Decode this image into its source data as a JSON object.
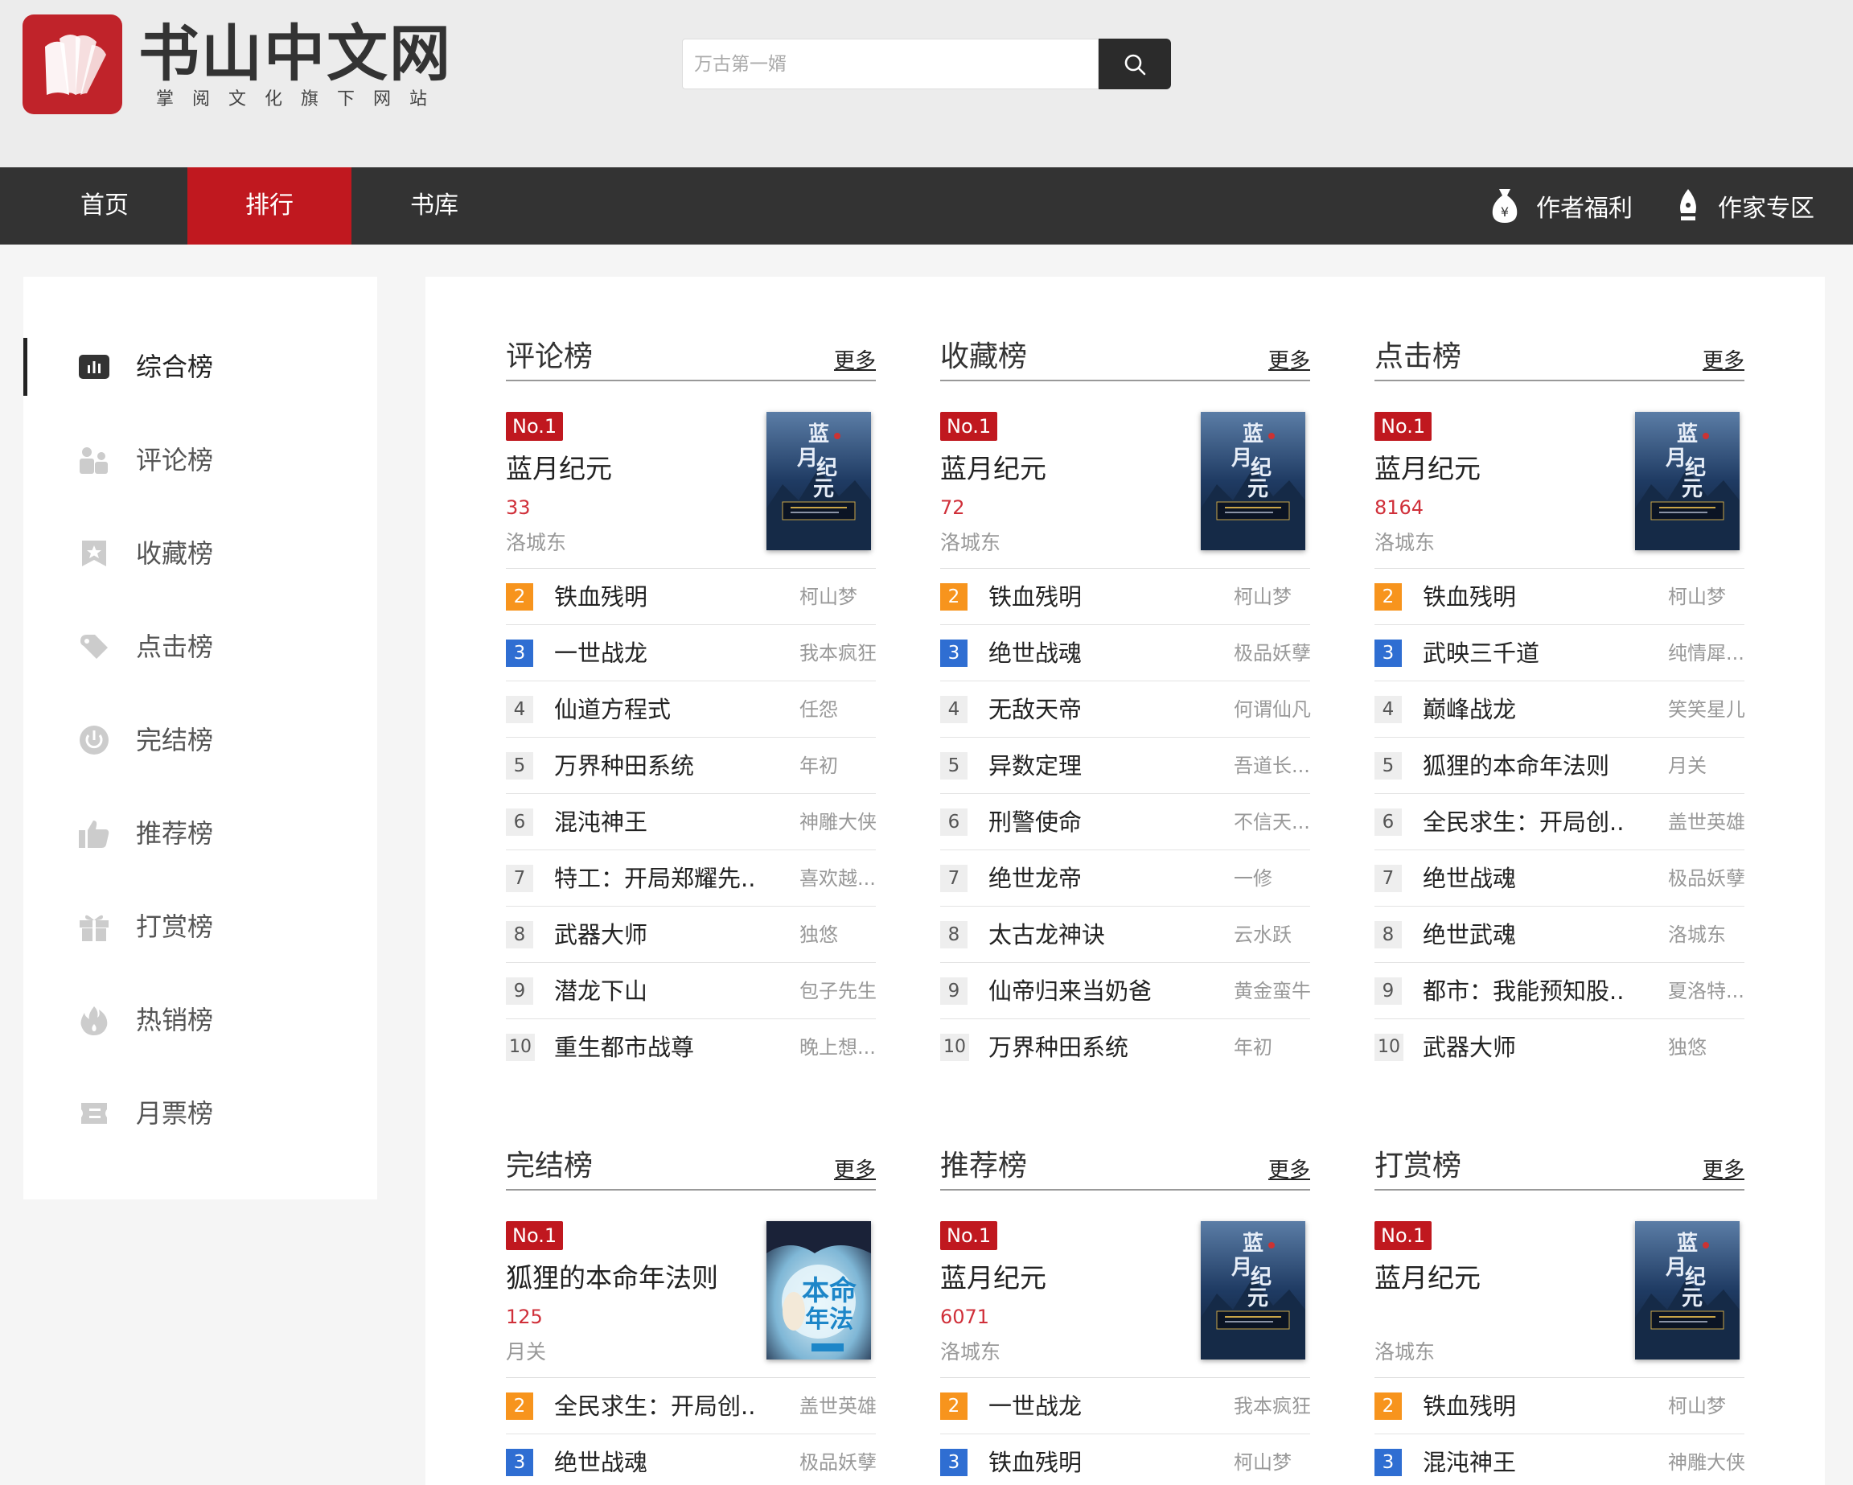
{
  "site": {
    "name": "书山中文网",
    "tagline": "掌阅文化旗下网站"
  },
  "search": {
    "placeholder": "万古第一婿"
  },
  "nav": {
    "items": [
      "首页",
      "排行",
      "书库"
    ],
    "active": "排行",
    "author_welfare": "作者福利",
    "writer_zone": "作家专区"
  },
  "sidebar": {
    "items": [
      {
        "label": "综合榜",
        "icon": "bar-chart-icon"
      },
      {
        "label": "评论榜",
        "icon": "users-icon"
      },
      {
        "label": "收藏榜",
        "icon": "bookmark-icon"
      },
      {
        "label": "点击榜",
        "icon": "tag-icon"
      },
      {
        "label": "完结榜",
        "icon": "power-icon"
      },
      {
        "label": "推荐榜",
        "icon": "thumbs-up-icon"
      },
      {
        "label": "打赏榜",
        "icon": "gift-icon"
      },
      {
        "label": "热销榜",
        "icon": "flame-icon"
      },
      {
        "label": "月票榜",
        "icon": "ticket-icon"
      }
    ]
  },
  "no1_label": "No.1",
  "more_label": "更多",
  "panels": [
    {
      "title": "评论榜",
      "top": {
        "name": "蓝月纪元",
        "count": "33",
        "author": "洛城东",
        "cover": "blue"
      },
      "rows": [
        {
          "rank": "2",
          "name": "铁血残明",
          "author": "柯山梦"
        },
        {
          "rank": "3",
          "name": "一世战龙",
          "author": "我本疯狂"
        },
        {
          "rank": "4",
          "name": "仙道方程式",
          "author": "任怨"
        },
        {
          "rank": "5",
          "name": "万界种田系统",
          "author": "年初"
        },
        {
          "rank": "6",
          "name": "混沌神王",
          "author": "神雕大侠"
        },
        {
          "rank": "7",
          "name": "特工：开局郑耀先...",
          "author": "喜欢越..."
        },
        {
          "rank": "8",
          "name": "武器大师",
          "author": "独悠"
        },
        {
          "rank": "9",
          "name": "潜龙下山",
          "author": "包子先生"
        },
        {
          "rank": "10",
          "name": "重生都市战尊",
          "author": "晚上想..."
        }
      ]
    },
    {
      "title": "收藏榜",
      "top": {
        "name": "蓝月纪元",
        "count": "72",
        "author": "洛城东",
        "cover": "blue"
      },
      "rows": [
        {
          "rank": "2",
          "name": "铁血残明",
          "author": "柯山梦"
        },
        {
          "rank": "3",
          "name": "绝世战魂",
          "author": "极品妖孽"
        },
        {
          "rank": "4",
          "name": "无敌天帝",
          "author": "何谓仙凡"
        },
        {
          "rank": "5",
          "name": "异数定理",
          "author": "吾道长..."
        },
        {
          "rank": "6",
          "name": "刑警使命",
          "author": "不信天..."
        },
        {
          "rank": "7",
          "name": "绝世龙帝",
          "author": "一修"
        },
        {
          "rank": "8",
          "name": "太古龙神诀",
          "author": "云水跃"
        },
        {
          "rank": "9",
          "name": "仙帝归来当奶爸",
          "author": "黄金蛮牛"
        },
        {
          "rank": "10",
          "name": "万界种田系统",
          "author": "年初"
        }
      ]
    },
    {
      "title": "点击榜",
      "top": {
        "name": "蓝月纪元",
        "count": "8164",
        "author": "洛城东",
        "cover": "blue"
      },
      "rows": [
        {
          "rank": "2",
          "name": "铁血残明",
          "author": "柯山梦"
        },
        {
          "rank": "3",
          "name": "武映三千道",
          "author": "纯情犀..."
        },
        {
          "rank": "4",
          "name": "巅峰战龙",
          "author": "笑笑星儿"
        },
        {
          "rank": "5",
          "name": "狐狸的本命年法则",
          "author": "月关"
        },
        {
          "rank": "6",
          "name": "全民求生：开局创...",
          "author": "盖世英雄"
        },
        {
          "rank": "7",
          "name": "绝世战魂",
          "author": "极品妖孽"
        },
        {
          "rank": "8",
          "name": "绝世武魂",
          "author": "洛城东"
        },
        {
          "rank": "9",
          "name": "都市：我能预知股...",
          "author": "夏洛特..."
        },
        {
          "rank": "10",
          "name": "武器大师",
          "author": "独悠"
        }
      ]
    },
    {
      "title": "完结榜",
      "top": {
        "name": "狐狸的本命年法则",
        "count": "125",
        "author": "月关",
        "cover": "fox"
      },
      "rows": [
        {
          "rank": "2",
          "name": "全民求生：开局创...",
          "author": "盖世英雄"
        },
        {
          "rank": "3",
          "name": "绝世战魂",
          "author": "极品妖孽"
        }
      ]
    },
    {
      "title": "推荐榜",
      "top": {
        "name": "蓝月纪元",
        "count": "6071",
        "author": "洛城东",
        "cover": "blue"
      },
      "rows": [
        {
          "rank": "2",
          "name": "一世战龙",
          "author": "我本疯狂"
        },
        {
          "rank": "3",
          "name": "铁血残明",
          "author": "柯山梦"
        }
      ]
    },
    {
      "title": "打赏榜",
      "top": {
        "name": "蓝月纪元",
        "count": "",
        "author": "洛城东",
        "cover": "blue"
      },
      "rows": [
        {
          "rank": "2",
          "name": "铁血残明",
          "author": "柯山梦"
        },
        {
          "rank": "3",
          "name": "混沌神王",
          "author": "神雕大侠"
        }
      ]
    }
  ],
  "colors": {
    "brand_red": "#c0181f",
    "nav_bg": "#333333",
    "rank2": "#f7941d",
    "rank3": "#2f6ed2",
    "count_red": "#d0303a"
  }
}
